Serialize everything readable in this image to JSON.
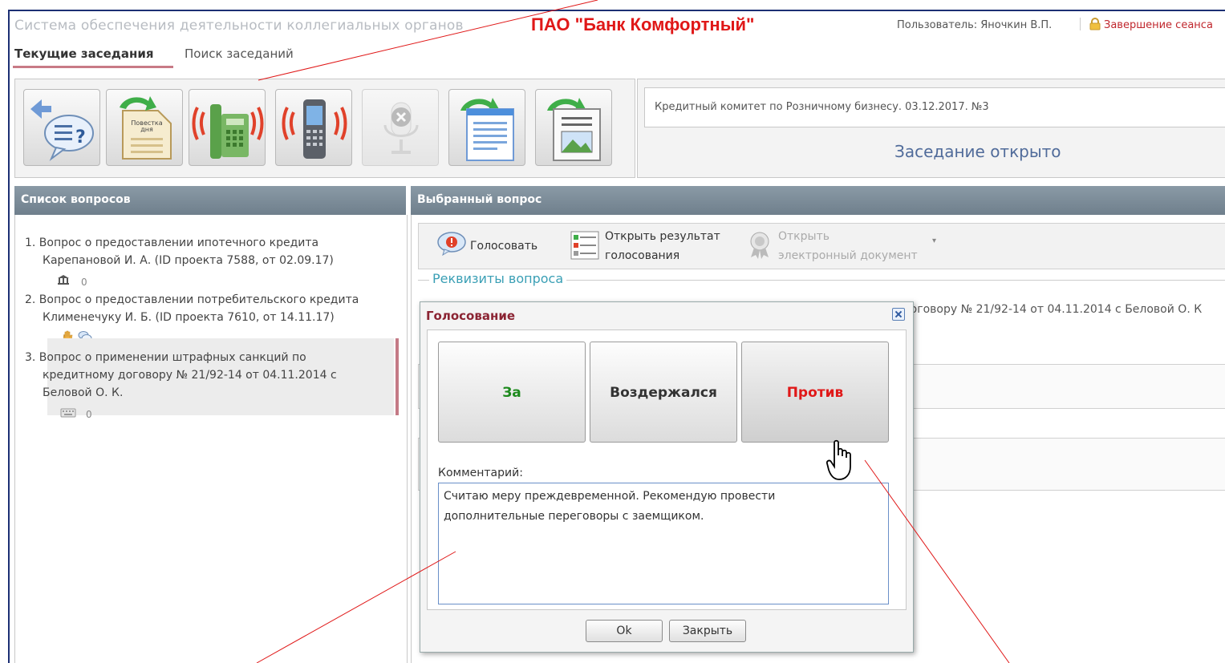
{
  "header": {
    "app_title": "Система обеспечения деятельности коллегиальных органов",
    "bank_name": "ПАО \"Банк Комфортный\"",
    "user": "Пользователь: Яночкин В.П.",
    "logout": "Завершение сеанса"
  },
  "tabs": [
    "Текущие заседания",
    "Поиск заседаний"
  ],
  "toolbar": {
    "agenda_label_1": "Повестка",
    "agenda_label_2": "дня"
  },
  "meeting": {
    "title": "Кредитный комитет по Розничному бизнесу. 03.12.2017. №3",
    "status": "Заседание открыто"
  },
  "questions_panel": {
    "header": "Список вопросов",
    "items": [
      {
        "line1": "1. Вопрос о предоставлении ипотечного кредита",
        "line2": "Карепановой И. А. (ID проекта 7588, от 02.09.17)",
        "meta": "0"
      },
      {
        "line1": "2. Вопрос о предоставлении потребительского кредита",
        "line2": "Клименечуку И. Б. (ID проекта 7610, от 14.11.17)",
        "meta": ""
      },
      {
        "line1": "3. Вопрос о применении штрафных санкций по",
        "line2": "кредитному договору № 21/92-14 от 04.11.2014 с",
        "line3": "Беловой О. К.",
        "meta": "0"
      }
    ]
  },
  "selected_panel": {
    "header": "Выбранный вопрос",
    "vote_action": "Голосовать",
    "results_action_1": "Открыть результат",
    "results_action_2": "голосования",
    "doc_action_1": "Открыть",
    "doc_action_2": "электронный документ",
    "legend": "Реквизиты вопроса",
    "background_text": "договору № 21/92-14 от 04.11.2014 с Беловой О. К"
  },
  "dialog": {
    "title": "Голосование",
    "vote_for": "За",
    "vote_abstain": "Воздержался",
    "vote_against": "Против",
    "comment_label": "Комментарий:",
    "comment_value": "Считаю меру преждевременной. Рекомендую провести\nдополнительные переговоры с заемщиком.",
    "ok_label": "Ok",
    "close_label": "Закрыть"
  },
  "colors": {
    "bank_name": "#e01818",
    "panel_header": "#7b8b98",
    "vote_for": "#1d8a1d",
    "vote_against": "#e01818",
    "dialog_title": "#8b2433",
    "status": "#506b9a"
  }
}
